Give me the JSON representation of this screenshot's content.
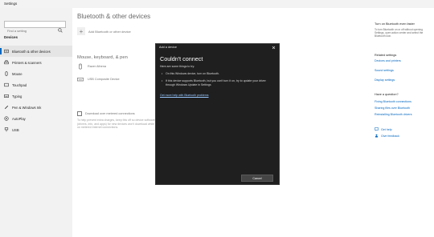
{
  "window": {
    "title": "Settings"
  },
  "sidebar": {
    "search_placeholder": "Find a setting",
    "section_label": "Devices",
    "items": [
      {
        "label": "Bluetooth & other devices",
        "icon": "bluetooth-icon",
        "active": true
      },
      {
        "label": "Printers & scanners",
        "icon": "printer-icon"
      },
      {
        "label": "Mouse",
        "icon": "mouse-icon"
      },
      {
        "label": "Touchpad",
        "icon": "touchpad-icon"
      },
      {
        "label": "Typing",
        "icon": "keyboard-icon"
      },
      {
        "label": "Pen & Windows Ink",
        "icon": "pen-icon"
      },
      {
        "label": "AutoPlay",
        "icon": "autoplay-icon"
      },
      {
        "label": "USB",
        "icon": "usb-icon"
      }
    ]
  },
  "main": {
    "title": "Bluetooth & other devices",
    "add_device_label": "Add Bluetooth or other device",
    "section_title": "Mouse, keyboard, & pen",
    "devices": [
      {
        "name": "Razer Athena",
        "icon": "mouse-icon"
      },
      {
        "name": "USB Composite Device",
        "icon": "keyboard-icon"
      }
    ],
    "metered_label": "Download over metered connections",
    "metered_description": "To help prevent extra charges, keep this off so device software (drivers, info, and apps) for new devices won't download while you're on metered Internet connections."
  },
  "right_panel": {
    "bluetooth_heading": "Turn on Bluetooth even faster",
    "bluetooth_text": "To turn Bluetooth on or off without opening Settings, open action center and select the Bluetooth icon.",
    "related_heading": "Related settings",
    "related_links": [
      "Devices and printers",
      "Sound settings",
      "Display settings"
    ],
    "question_heading": "Have a question?",
    "question_links": [
      "Fixing Bluetooth connections",
      "Sharing files over Bluetooth",
      "Reinstalling Bluetooth drivers"
    ],
    "help_label": "Get help",
    "feedback_label": "Give feedback"
  },
  "dialog": {
    "title": "Add a device",
    "heading": "Couldn't connect",
    "intro": "Here are some things to try:",
    "bullets": [
      "On this Windows device, turn on Bluetooth.",
      "If this device supports Bluetooth, but you can't turn it on, try to update your driver through Windows Update in Settings"
    ],
    "help_link": "Get more help with Bluetooth problems",
    "cancel_label": "Cancel"
  },
  "colors": {
    "accent": "#0067c0",
    "dialog_bg": "#1f1f1f",
    "sidebar_bg": "#f2f2f2"
  }
}
